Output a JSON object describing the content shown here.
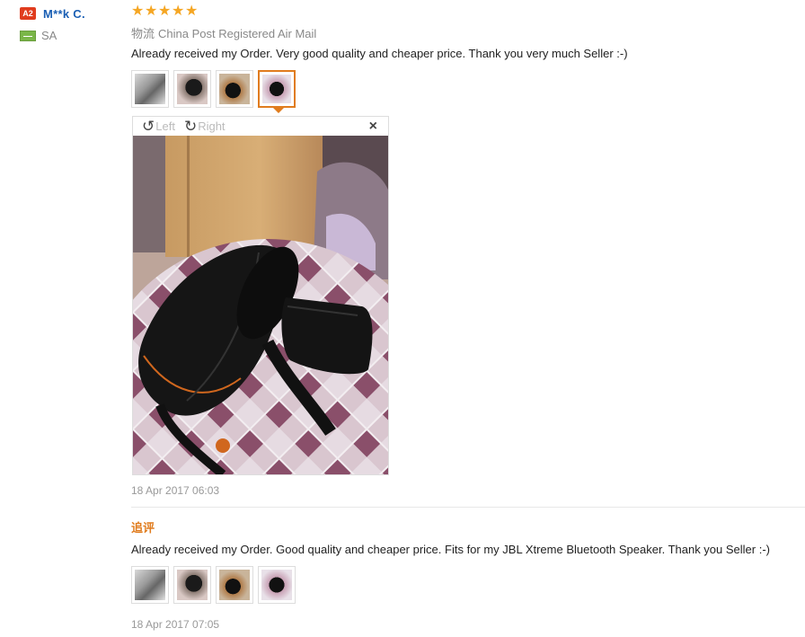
{
  "user": {
    "level": "A2",
    "name": "M**k C.",
    "country": "SA"
  },
  "review": {
    "rating": 5,
    "logistics_label": "物流",
    "logistics_value": "China Post Registered Air Mail",
    "text": "Already received my Order. Very good quality and cheaper price. Thank you very much Seller :-)",
    "date": "18 Apr 2017 06:03",
    "viewer": {
      "rotate_left": "Left",
      "rotate_right": "Right",
      "close": "×"
    }
  },
  "followup": {
    "label": "追评",
    "text": "Already received my Order. Good quality and cheaper price. Fits for my JBL Xtreme Bluetooth Speaker. Thank you Seller :-)",
    "date": "18 Apr 2017 07:05"
  },
  "colors": {
    "accent": "#e07c1e",
    "star": "#f5a623",
    "username": "#1a5fb4",
    "badge": "#e03c1e"
  }
}
